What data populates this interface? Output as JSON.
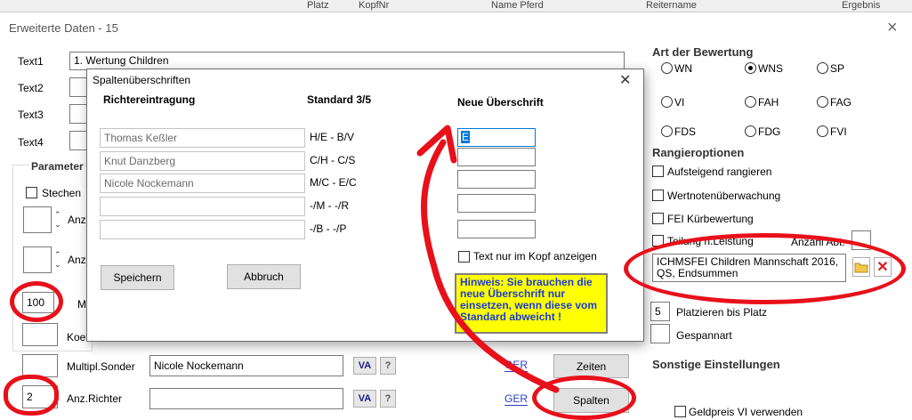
{
  "background_header": {
    "cols": [
      "Platz",
      "KopfNr",
      "Name Pferd",
      "Reitername",
      "Ergebnis"
    ]
  },
  "window": {
    "title": "Erweiterte Daten - 15",
    "close_glyph": "×"
  },
  "texts": {
    "text1_label": "Text1",
    "text1_value": "1. Wertung Children",
    "text2_label": "Text2",
    "text3_label": "Text3",
    "text4_label": "Text4"
  },
  "parameter": {
    "title": "Parameter",
    "stechen_label": "Stechen",
    "anz1_label": "Anz.",
    "anz2_label": "Anz",
    "max_value": "100",
    "max_label": "Ma",
    "koef_label": "Koef",
    "multipl_label": "Multipl.Sonder",
    "anz_richter_value": "2",
    "anz_richter_label": "Anz.Richter"
  },
  "judges_row": {
    "name1": "Nicole Nockemann",
    "name2": "",
    "va_label": "VA",
    "q_label": "?",
    "ger_label": "GER",
    "zeiten_label": "Zeiten",
    "spalten_label": "Spalten"
  },
  "bewertung": {
    "title": "Art der Bewertung",
    "options": [
      {
        "label": "WN",
        "checked": false
      },
      {
        "label": "WNS",
        "checked": true
      },
      {
        "label": "SP",
        "checked": false
      },
      {
        "label": "VI",
        "checked": false
      },
      {
        "label": "FAH",
        "checked": false
      },
      {
        "label": "FAG",
        "checked": false
      },
      {
        "label": "FDS",
        "checked": false
      },
      {
        "label": "FDG",
        "checked": false
      },
      {
        "label": "FVI",
        "checked": false
      }
    ]
  },
  "rangier": {
    "title": "Rangieroptionen",
    "aufsteigend": "Aufsteigend rangieren",
    "wertnoten": "Wertnotenüberwachung",
    "fei": "FEI Kürbewertung",
    "teilung": "Teilung n.Leistung",
    "anzahl_abt": "Anzahl Abt.",
    "file_text": "ICHMSFEI Children Mannschaft 2016, QS, Endsummen",
    "platzieren_value": "5",
    "platzieren_label": "Platzieren bis Platz",
    "gespannt_label": "Gespannart"
  },
  "sonstige": {
    "title": "Sonstige Einstellungen",
    "geldpreis": "Geldpreis VI verwenden"
  },
  "dialog": {
    "title": "Spaltenüberschriften",
    "close_glyph": "✕",
    "col1_header": "Richtereintragung",
    "col2_header": "Standard  3/5",
    "col3_header": "Neue Überschrift",
    "rows": [
      {
        "judge": "Thomas Keßler",
        "standard": "H/E - B/V",
        "neu": "E"
      },
      {
        "judge": "Knut Danzberg",
        "standard": "C/H - C/S",
        "neu": ""
      },
      {
        "judge": "Nicole Nockemann",
        "standard": "M/C - E/C",
        "neu": ""
      },
      {
        "judge": "",
        "standard": "-/M - -/R",
        "neu": ""
      },
      {
        "judge": "",
        "standard": "-/B - -/P",
        "neu": ""
      }
    ],
    "text_nur_kopf": "Text nur im Kopf anzeigen",
    "hint": "Hinweis: Sie brauchen die neue Überschrift nur einsetzen, wenn diese vom Standard abweicht !",
    "save_label": "Speichern",
    "cancel_label": "Abbruch"
  },
  "colors": {
    "annotation_red": "#e8101a",
    "hint_bg": "#ffff00",
    "hint_text": "#1a3ad8",
    "link_blue": "#2a40c8"
  }
}
